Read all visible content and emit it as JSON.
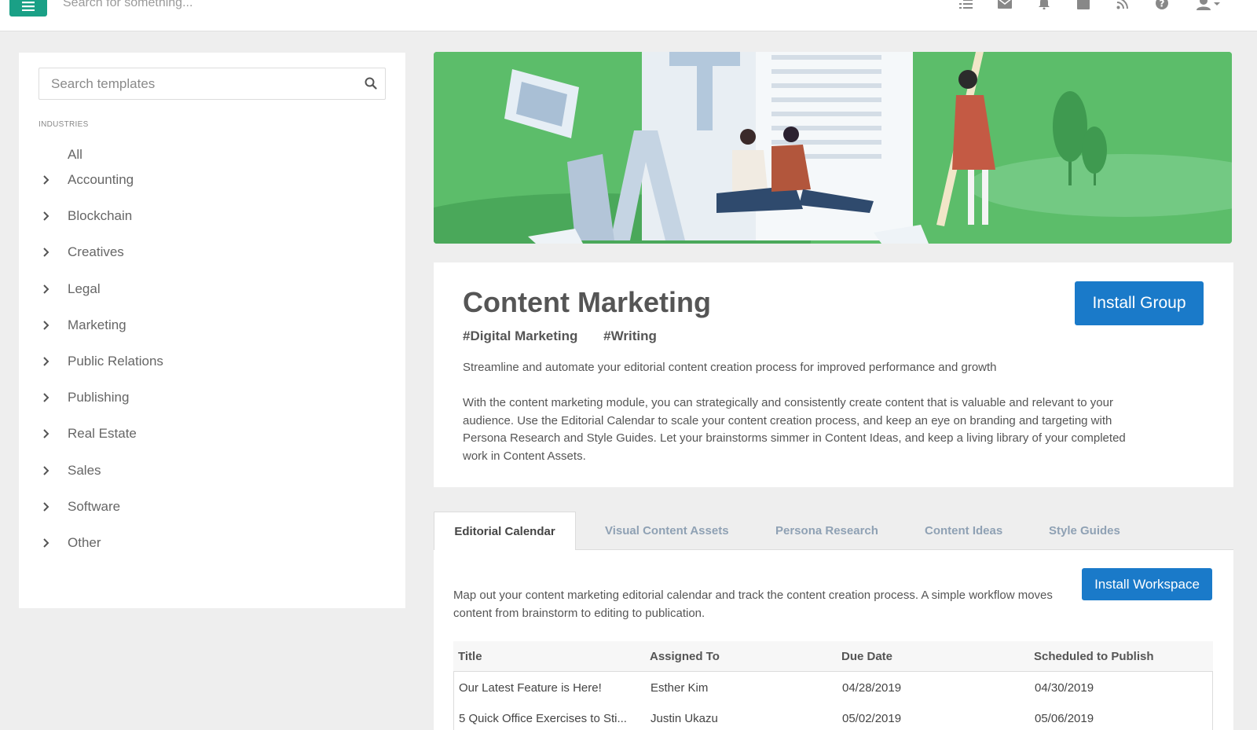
{
  "topbar": {
    "search_placeholder": "Search for something...",
    "icons": [
      "list-icon",
      "mail-icon",
      "bell-icon",
      "calendar-icon",
      "rss-icon",
      "help-icon",
      "user-icon"
    ],
    "accent": "#1aa086"
  },
  "sidebar": {
    "search_placeholder": "Search templates",
    "section_label": "INDUSTRIES",
    "all_label": "All",
    "items": [
      {
        "label": "Accounting"
      },
      {
        "label": "Blockchain"
      },
      {
        "label": "Creatives"
      },
      {
        "label": "Legal"
      },
      {
        "label": "Marketing"
      },
      {
        "label": "Public Relations"
      },
      {
        "label": "Publishing"
      },
      {
        "label": "Real Estate"
      },
      {
        "label": "Sales"
      },
      {
        "label": "Software"
      },
      {
        "label": "Other"
      }
    ]
  },
  "banner": {
    "background": "#5cbd6a"
  },
  "group": {
    "title": "Content Marketing",
    "tags": [
      "#Digital Marketing",
      "#Writing"
    ],
    "tagline": "Streamline and automate your editorial content creation process for improved performance and growth",
    "description": "With the content marketing module, you can strategically and consistently create content that is valuable and relevant to your audience. Use the Editorial Calendar to scale your content creation process, and keep an eye on branding and targeting with Persona Research and Style Guides. Let your brainstorms simmer in Content Ideas, and keep a living library of your completed work in Content Assets.",
    "install_label": "Install Group",
    "button_color": "#1a7ac9"
  },
  "tabs": [
    {
      "label": "Editorial Calendar",
      "active": true
    },
    {
      "label": "Visual Content Assets",
      "active": false
    },
    {
      "label": "Persona Research",
      "active": false
    },
    {
      "label": "Content Ideas",
      "active": false
    },
    {
      "label": "Style Guides",
      "active": false
    }
  ],
  "workspace": {
    "install_label": "Install Workspace",
    "description": "Map out your content marketing editorial calendar and track the content creation process. A simple workflow moves content from brainstorm to editing to publication.",
    "table": {
      "headers": [
        "Title",
        "Assigned To",
        "Due Date",
        "Scheduled to Publish"
      ],
      "rows": [
        [
          "Our Latest Feature is Here!",
          "Esther Kim",
          "04/28/2019",
          "04/30/2019"
        ],
        [
          "5 Quick Office Exercises to Sti...",
          "Justin Ukazu",
          "05/02/2019",
          "05/06/2019"
        ]
      ]
    }
  }
}
